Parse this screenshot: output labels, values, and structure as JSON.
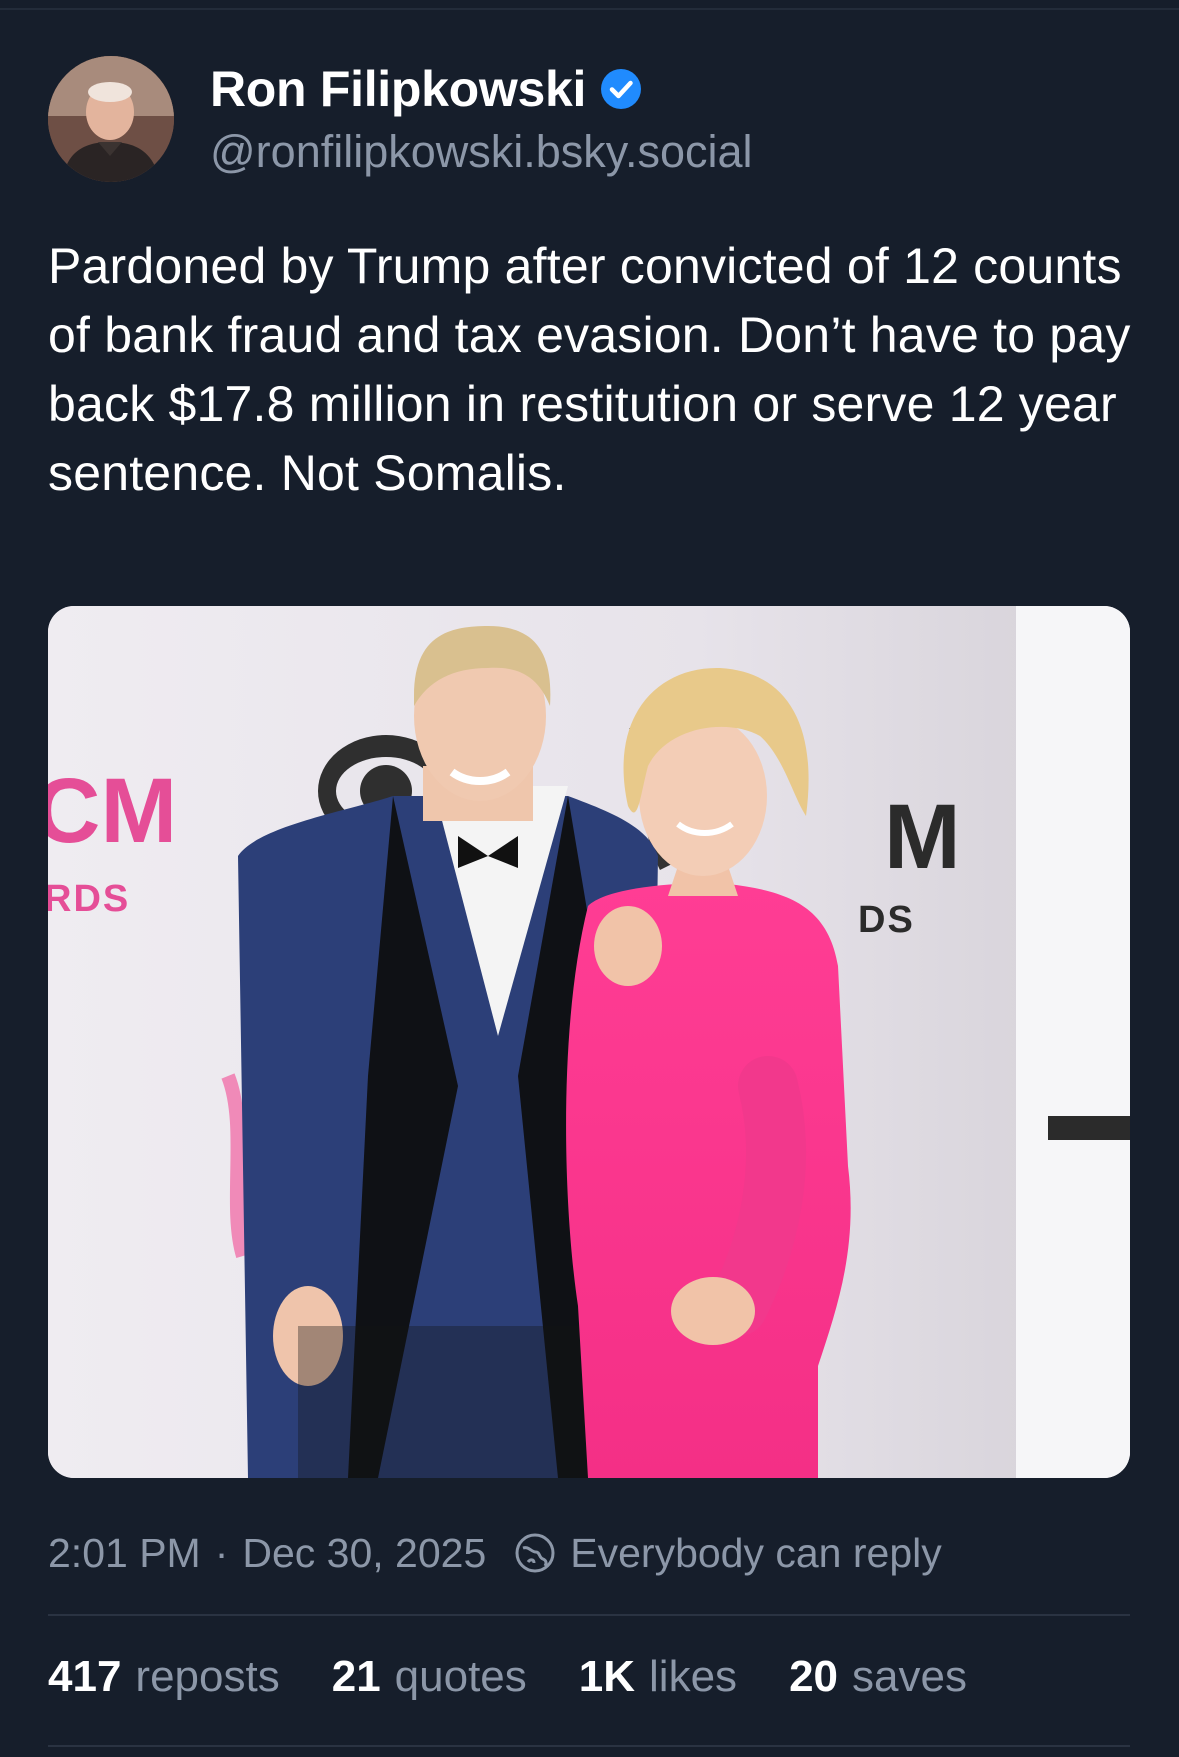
{
  "author": {
    "display_name": "Ron Filipkowski",
    "handle": "@ronfilipkowski.bsky.social",
    "verified": true,
    "avatar_icon": "profile-photo"
  },
  "post": {
    "text": "Pardoned by Trump after convicted of 12 counts of bank fraud and tax evasion. Don’t have to pay back $17.8 million in restitution or serve 12 year sentence. Not Somalis.",
    "image_backdrop_text": {
      "left_big": "CM",
      "left_small": "RDS",
      "right_big": "M",
      "right_small": "DS"
    }
  },
  "meta": {
    "time": "2:01 PM",
    "separator": "·",
    "date": "Dec 30, 2025",
    "reply_setting": "Everybody can reply",
    "reply_icon": "globe-icon"
  },
  "stats": {
    "reposts_count": "417",
    "reposts_label": "reposts",
    "quotes_count": "21",
    "quotes_label": "quotes",
    "likes_count": "1K",
    "likes_label": "likes",
    "saves_count": "20",
    "saves_label": "saves"
  },
  "colors": {
    "background": "#161e2b",
    "text_primary": "#ffffff",
    "text_secondary": "#8c97a8",
    "verified_blue": "#208bfe",
    "divider": "#2a3342"
  }
}
